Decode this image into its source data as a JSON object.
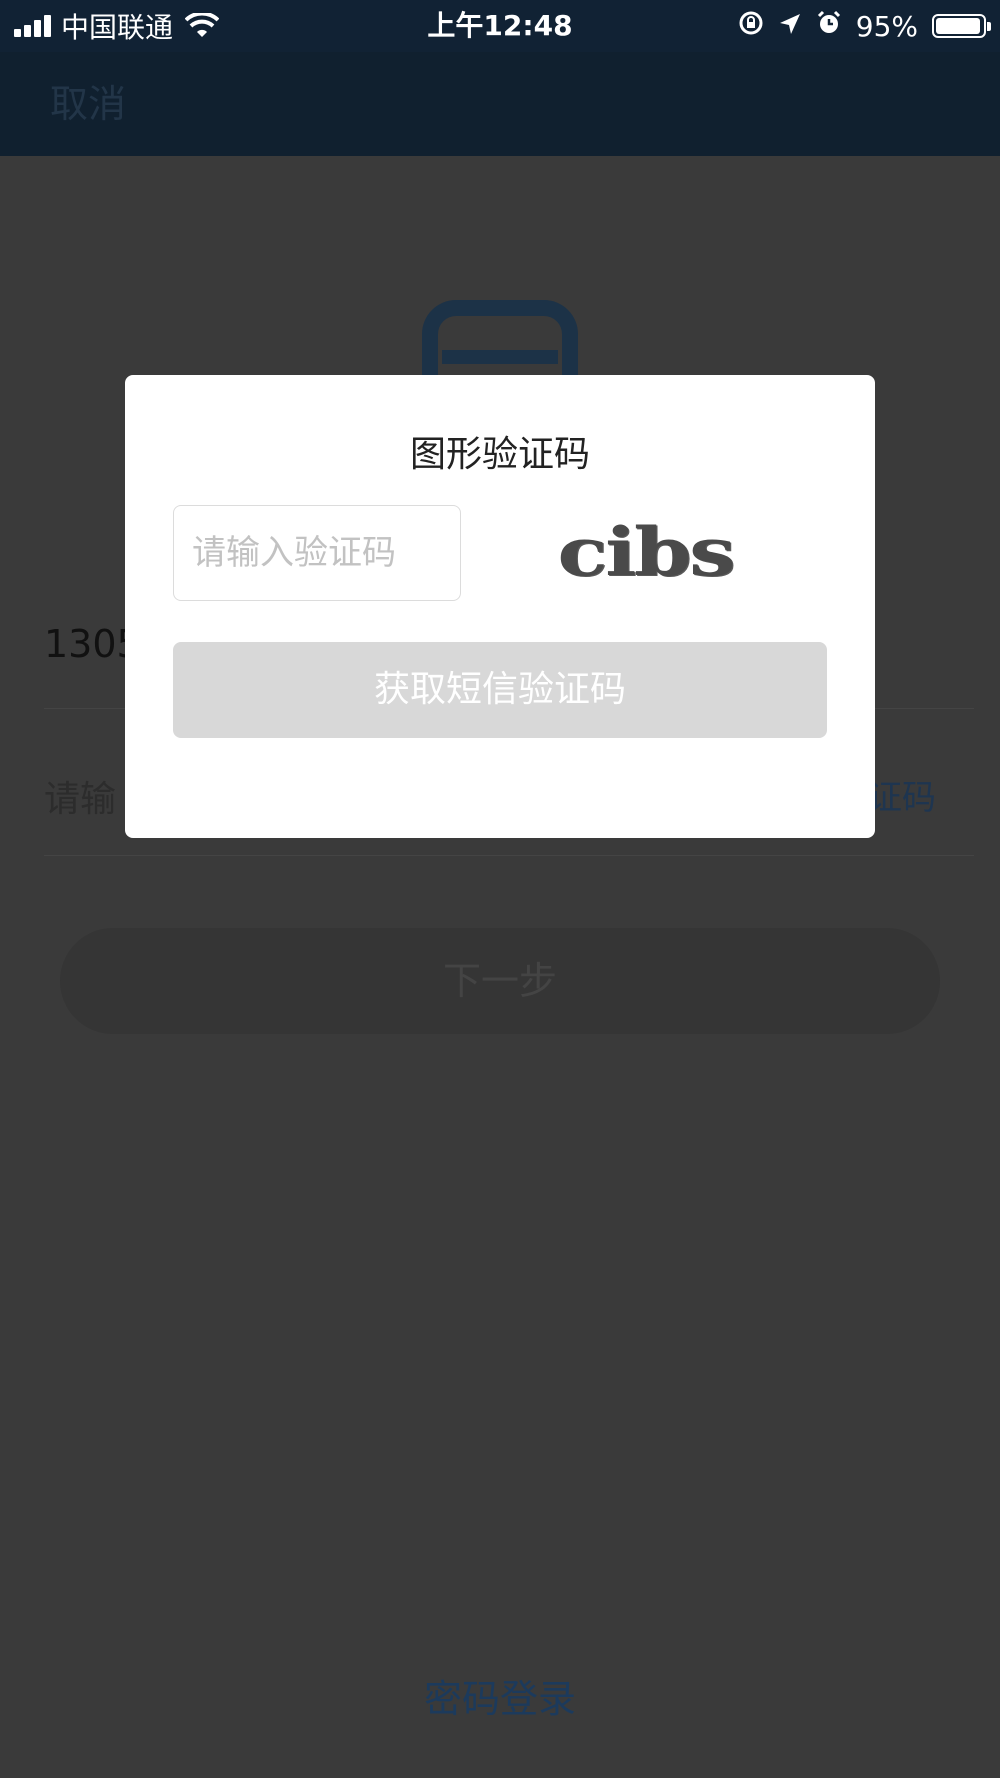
{
  "status_bar": {
    "carrier": "中国联通",
    "time": "上午12:48",
    "battery_percent": "95%",
    "battery_level": 0.95,
    "icons": [
      "signal-icon",
      "wifi-icon",
      "orientation-lock-icon",
      "location-icon",
      "alarm-icon",
      "battery-icon"
    ]
  },
  "nav": {
    "cancel_label": "取消"
  },
  "background": {
    "phone_partial": "1305",
    "code_placeholder_partial": "请输",
    "get_code_partial": "证码",
    "next_label": "下一步",
    "password_login": "密码登录"
  },
  "dialog": {
    "title": "图形验证码",
    "input_placeholder": "请输入验证码",
    "input_value": "",
    "captcha_text": "cibs",
    "sms_button_label": "获取短信验证码"
  },
  "colors": {
    "status_bar_bg": "#112234",
    "overlay": "#3a3a3a",
    "dialog_bg": "#ffffff",
    "disabled_button": "#d8d8d8",
    "link_blue": "#1c3a5c"
  }
}
